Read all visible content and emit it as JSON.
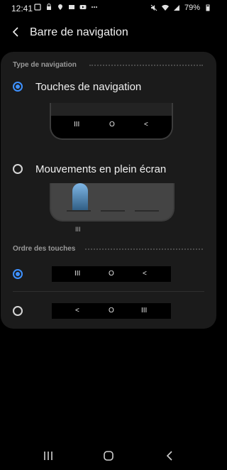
{
  "status_bar": {
    "time": "12:41",
    "battery": "79%"
  },
  "header": {
    "title": "Barre de navigation"
  },
  "navigation_type": {
    "section_label": "Type de navigation",
    "options": [
      {
        "label": "Touches de navigation",
        "selected": true
      },
      {
        "label": "Mouvements en plein écran",
        "selected": false
      }
    ]
  },
  "button_order": {
    "section_label": "Ordre des touches",
    "options": [
      {
        "selected": true,
        "keys": [
          "III",
          "O",
          "<"
        ]
      },
      {
        "selected": false,
        "keys": [
          "<",
          "O",
          "III"
        ]
      }
    ]
  },
  "illustration": {
    "nav_keys": [
      "III",
      "O",
      "<"
    ],
    "menu_glyph": "III"
  },
  "colors": {
    "accent": "#3e91ff",
    "card": "#1b1b1b",
    "background": "#000000"
  },
  "icons": [
    "back-arrow-icon",
    "recent-apps-icon",
    "home-icon",
    "back-icon",
    "battery-icon",
    "wifi-icon",
    "signal-icon"
  ]
}
